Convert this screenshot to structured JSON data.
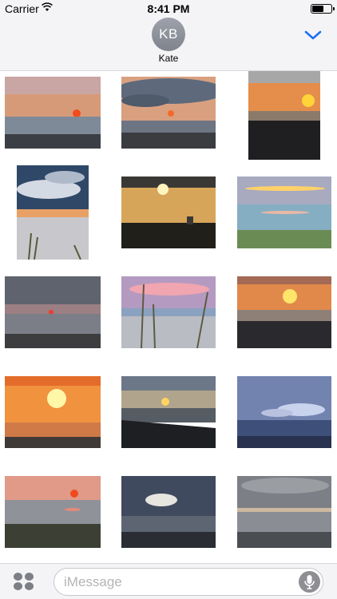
{
  "status_bar": {
    "carrier": "Carrier",
    "time": "8:41 PM",
    "battery_level": 0.62
  },
  "header": {
    "avatar_initials": "KB",
    "contact_name": "Kate",
    "collapse_icon": "chevron-down-icon",
    "accent_color": "#1e6ff2"
  },
  "photos": [
    {
      "label": "sunset-1",
      "theme": "a"
    },
    {
      "label": "sunset-2",
      "theme": "b"
    },
    {
      "label": "sunset-3",
      "theme": "c"
    },
    {
      "label": "sunset-4",
      "theme": "d"
    },
    {
      "label": "sunset-5",
      "theme": "e"
    },
    {
      "label": "sunset-6",
      "theme": "f"
    },
    {
      "label": "sunset-7",
      "theme": "g"
    },
    {
      "label": "sunset-8",
      "theme": "h"
    },
    {
      "label": "sunset-9",
      "theme": "i"
    },
    {
      "label": "sunset-10",
      "theme": "j"
    },
    {
      "label": "sunset-11",
      "theme": "k"
    },
    {
      "label": "sunset-12",
      "theme": "l"
    },
    {
      "label": "sunset-13",
      "theme": "m"
    },
    {
      "label": "sunset-14",
      "theme": "n"
    },
    {
      "label": "sunset-15",
      "theme": "o"
    }
  ],
  "input_bar": {
    "placeholder": "iMessage",
    "apps_icon": "app-drawer-icon",
    "mic_icon": "microphone-icon"
  }
}
